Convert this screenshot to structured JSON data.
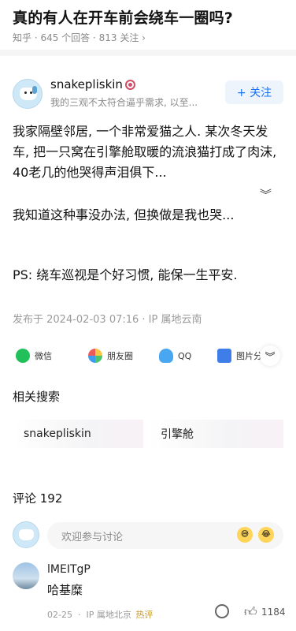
{
  "question": {
    "title": "真的有人在开车前会绕车一圈吗?",
    "meta": "知乎 · 645 个回答 · 813 关注 ›"
  },
  "author": {
    "name": "snakepliskin",
    "bio": "我的三观不太符合逼乎需求, 以至...",
    "follow_label": "+ 关注"
  },
  "answer": {
    "para1": "我家隔壁邻居, 一个非常爱猫之人. 某次冬天发车, 把一只窝在引擎舱取暖的流浪猫打成了肉沫, 40老几的他哭得声泪俱下...",
    "para2": "我知道这种事没办法, 但换做是我也哭...",
    "para3": "PS: 绕车巡视是个好习惯, 能保一生平安.",
    "post_meta": "发布于 2024-02-03 07:16 · IP 属地云南",
    "expand_glyph": "︾"
  },
  "share": {
    "wechat": "微信",
    "moments": "朋友圈",
    "qq": "QQ",
    "image": "图片分",
    "expand_glyph": "︾"
  },
  "related": {
    "title": "相关搜索",
    "items": [
      "snakepliskin",
      "引擎舱"
    ]
  },
  "comments": {
    "title": "评论 192",
    "input_placeholder": "欢迎参与讨论",
    "items": [
      {
        "name": "lMEITgP",
        "text": "哈基糜",
        "date": "02-25",
        "ip": "IP 属地北京",
        "tag": "热评",
        "likes": "1184"
      }
    ]
  },
  "colors": {
    "accent": "#1772f6",
    "badge": "#d14d6a",
    "hot": "#c59a2a"
  }
}
